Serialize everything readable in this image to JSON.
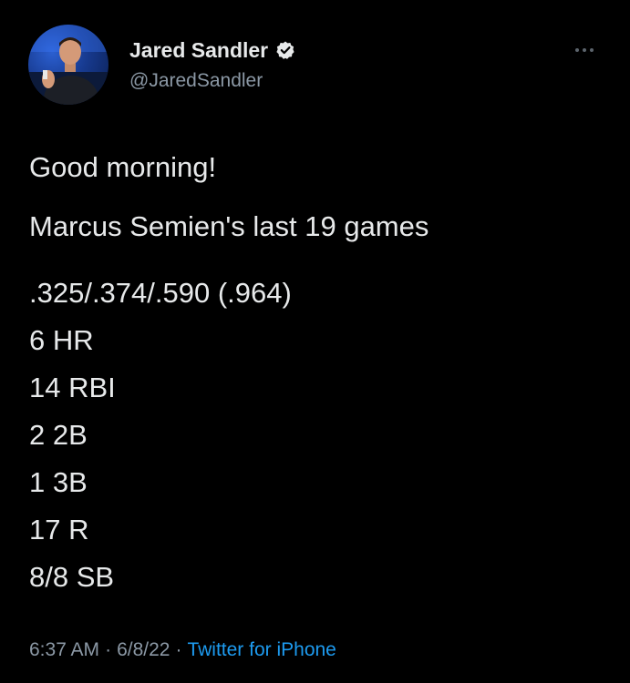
{
  "tweet": {
    "author": {
      "display_name": "Jared Sandler",
      "handle": "@JaredSandler",
      "verified": true,
      "avatar_icon": "profile-photo"
    },
    "more_icon": "more-horizontal-icon",
    "text": {
      "greeting": "Good morning!",
      "heading": "Marcus Semien's last 19 games",
      "stats": [
        ".325/.374/.590 (.964)",
        "6 HR",
        "14 RBI",
        "2 2B",
        "1 3B",
        "17 R",
        "8/8 SB"
      ]
    },
    "meta": {
      "time": "6:37 AM",
      "separator": "·",
      "date": "6/8/22",
      "source": "Twitter for iPhone"
    }
  },
  "colors": {
    "background": "#000000",
    "text_primary": "#E7E9EA",
    "text_secondary": "#8B98A5",
    "accent": "#1D9BF0"
  }
}
